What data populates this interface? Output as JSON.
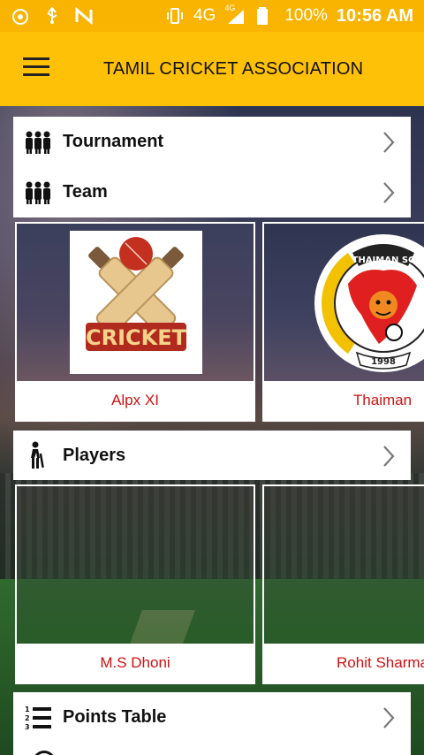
{
  "status_bar": {
    "network": "4G",
    "network_small": "4G",
    "battery": "100%",
    "time": "10:56 AM"
  },
  "app_bar": {
    "title": "TAMIL CRICKET ASSOCIATION",
    "menu_icon": "hamburger-menu-icon"
  },
  "sections": {
    "tournament": {
      "label": "Tournament",
      "icon": "people-group-icon"
    },
    "team": {
      "label": "Team",
      "icon": "people-group-icon"
    },
    "players": {
      "label": "Players",
      "icon": "cricket-player-icon"
    },
    "points_table": {
      "label": "Points Table",
      "icon": "numbered-list-icon"
    }
  },
  "teams": [
    {
      "name": "Alpx XI",
      "logo": "cricket-logo",
      "logo_text": "CRICKET"
    },
    {
      "name": "Thaiman",
      "logo": "thaiman-sc-logo",
      "logo_text": "THAIMAN SC",
      "logo_year": "1998"
    }
  ],
  "players": [
    {
      "name": "M.S Dhoni"
    },
    {
      "name": "Rohit Sharma"
    }
  ],
  "colors": {
    "primary": "#ffc107",
    "status_bar": "#f8b400",
    "caption_text": "#d01010"
  }
}
